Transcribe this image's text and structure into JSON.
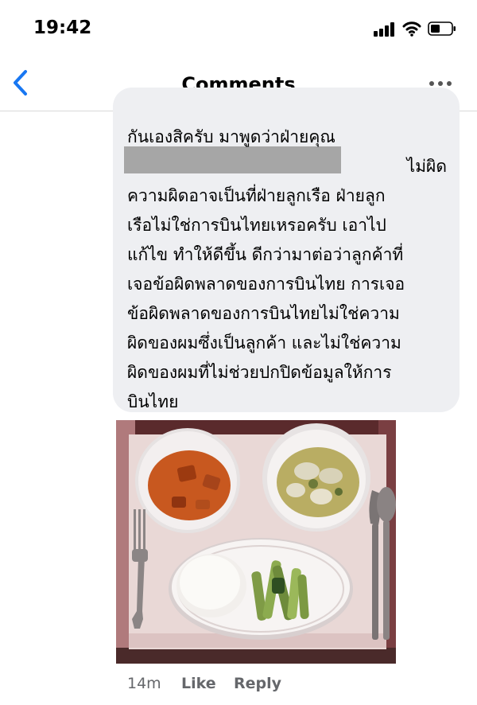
{
  "status_bar": {
    "time": "19:42",
    "icons": [
      "cellular-signal-icon",
      "wifi-icon",
      "battery-icon"
    ]
  },
  "nav": {
    "back_icon": "chevron-left-icon",
    "title": "Comments",
    "more_icon": "ellipsis-icon",
    "accent_color": "#1877f2"
  },
  "comment": {
    "lines": [
      "กันเองสิครับ มาพูดว่าฝ่ายคุณ",
      "ไม่ผิด",
      "ความผิดอาจเป็นที่ฝ่ายลูกเรือ ฝ่ายลูก",
      "เรือไม่ใช่การบินไทยเหรอครับ เอาไป",
      "แก้ไข ทำให้ดีขึ้น ดีกว่ามาต่อว่าลูกค้าที่",
      "เจอข้อผิดพลาดของการบินไทย การเจอ",
      "ข้อผิดพลาดของการบินไทยไม่ใช่ความ",
      "ผิดของผมซึ่งเป็นลูกค้า และไม่ใช่ความ",
      "ผิดของผมที่ไม่ช่วยปกปิดข้อมูลให้การ",
      "บินไทย"
    ],
    "bubble_color": "#eeeff2",
    "timestamp": "14m",
    "like_label": "Like",
    "reply_label": "Reply"
  }
}
